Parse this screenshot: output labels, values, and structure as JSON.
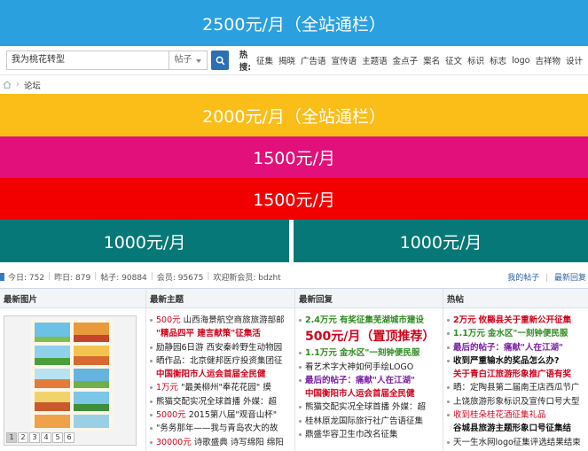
{
  "banners": {
    "b2500": "2500元/月（全站通栏）",
    "b2000": "2000元/月（全站通栏）",
    "b1500a": "1500元/月",
    "b1500b": "1500元/月",
    "b1000a": "1000元/月",
    "b1000b": "1000元/月"
  },
  "search": {
    "value": "我为桃花转型",
    "select": "帖子",
    "hot_label": "热搜:",
    "hot_items": [
      "征集",
      "揭晓",
      "广告语",
      "宣传语",
      "主题语",
      "金点子",
      "案名",
      "征文",
      "标识",
      "标志",
      "logo",
      "吉祥物",
      "设计"
    ]
  },
  "breadcrumb": {
    "label": "论坛"
  },
  "stats": {
    "today": "今日: 752",
    "yesterday": "昨日: 879",
    "posts": "帖子: 90884",
    "members": "会员: 95675",
    "welcome": "欢迎新会员: bdzht",
    "my_posts": "我的帖子",
    "latest_reply": "最新回复"
  },
  "columns": {
    "c1": "最新图片",
    "c2": "最新主题",
    "c3": "最新回复",
    "c4": "热帖"
  },
  "pager": [
    "1",
    "2",
    "3",
    "4",
    "5",
    "6"
  ],
  "topics": [
    {
      "a": "500元",
      "b": "山西海景航空商旅旅游部邮"
    },
    {
      "a": "\"精品四平 建言献策\"征集活"
    },
    {
      "a": "励静园6日游 西安秦岭野生动物园"
    },
    {
      "a": "晒作品：北京健邦医疗投资集团征"
    },
    {
      "a": "中国衡阳市人运会首届全民健"
    },
    {
      "a": "1万元",
      "b": "\"最美柳州\"奉花花园\" 摸"
    },
    {
      "a": "熊猫交配实况全球首播 外媒：超"
    },
    {
      "a": "5000元",
      "b": "2015第八届\"观音山杯\""
    },
    {
      "a": "\"务务那年——我与青岛农大的故"
    },
    {
      "a": "30000元",
      "b": "诗歌盛典 诗写绵阳 绵阳"
    }
  ],
  "replies": [
    {
      "a": "2.4万元",
      "b": "有奖征集芜湖城市建设"
    },
    {
      "a": "500元/月（置顶推荐）"
    },
    {
      "a": "1.1万元",
      "b": "金水区\"一刻钟便民服"
    },
    {
      "a": "看艺术字大神如何手绘LOGO"
    },
    {
      "a": "最后的帖子：痛献\"人在江湖\""
    },
    {
      "a": "中国衡阳市人运会首届全民健"
    },
    {
      "a": "熊猫交配实况全球首播 外媒：超"
    },
    {
      "a": "桂林原龙国际旅行社广告语征集"
    },
    {
      "a": "鼎盛华容卫生巾改名征集"
    }
  ],
  "hot_posts": [
    {
      "a": "2万元",
      "b": "攸縣县关于重新公开征集"
    },
    {
      "a": "1.1万元",
      "b": "金水区\"一刻钟便民服"
    },
    {
      "a": "最后的帖子：痛献\"人在江湖\""
    },
    {
      "a": "收到严重输水的奖品怎么办?"
    },
    {
      "a": "关于青白江旅游形象推广语有奖"
    },
    {
      "a": "晒：定陶县第二届南王店西瓜节广"
    },
    {
      "a": "上饶旅游形象标识及宣传口号大型"
    },
    {
      "a": "收到桂朵桂花酒征集礼品"
    },
    {
      "a": "谷城县旅游主题形象口号征集结"
    },
    {
      "a": "天一生水网logo征集评选结果结束"
    }
  ],
  "colors": {
    "b2500": "#2aa0de",
    "b2000": "#fbbd17",
    "b1500a": "#e1107a",
    "b1500b": "#f20000",
    "b1000": "#067877"
  }
}
